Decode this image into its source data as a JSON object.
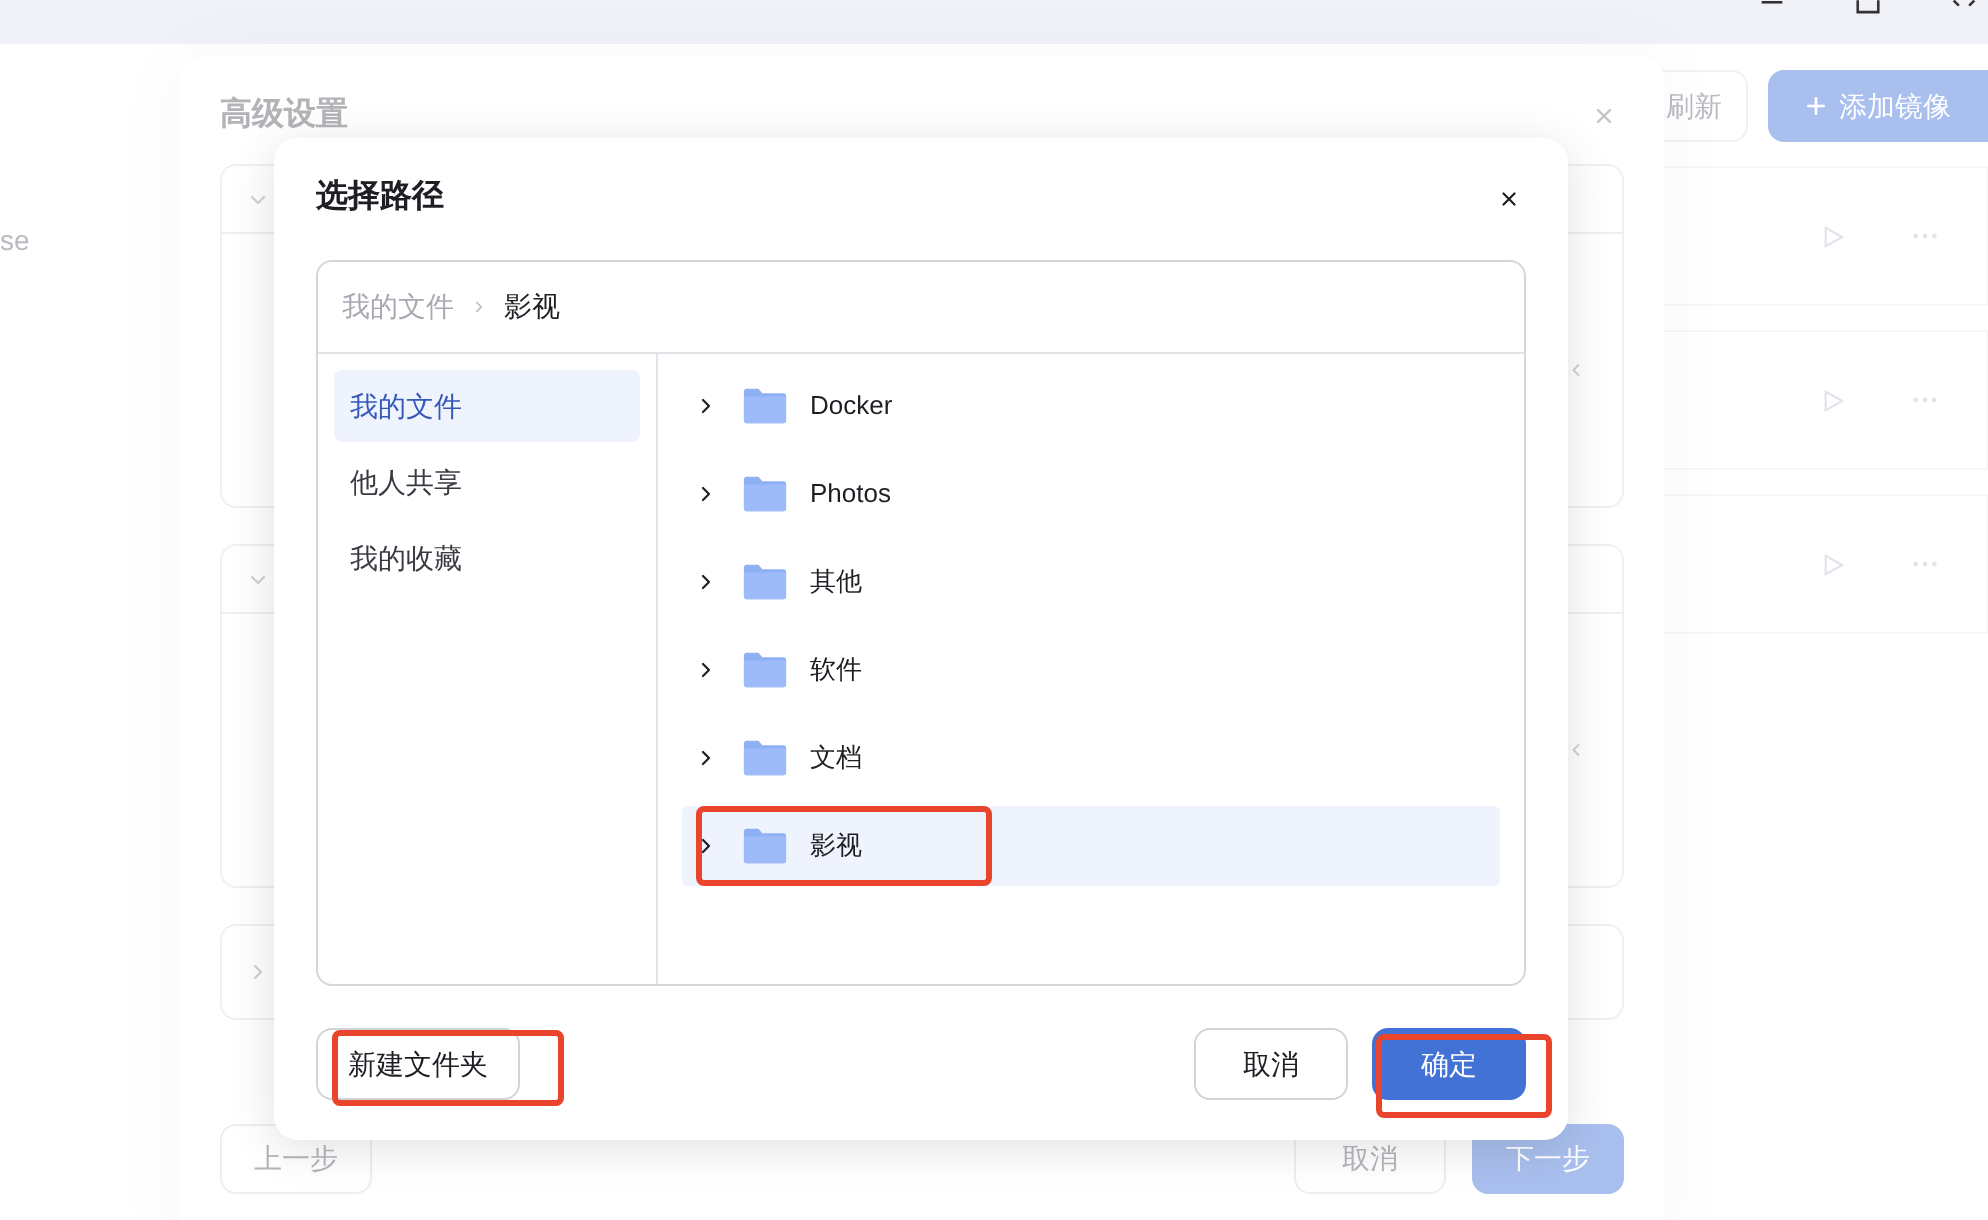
{
  "sidebar": {
    "items": [
      {
        "label": "se"
      }
    ]
  },
  "toolbar": {
    "refresh": "刷新",
    "add_image": "添加镜像",
    "add_icon": "+"
  },
  "background_list": {
    "rows": [
      {
        "kind": "row"
      },
      {
        "kind": "row"
      },
      {
        "kind": "row"
      }
    ]
  },
  "settings_dialog": {
    "title": "高级设置",
    "sections": [
      {
        "expanded": true
      },
      {
        "expanded": true
      },
      {
        "expanded": false
      }
    ],
    "buttons": {
      "back": "上一步",
      "cancel": "取消",
      "next": "下一步"
    }
  },
  "path_dialog": {
    "title": "选择路径",
    "breadcrumb": [
      {
        "label": "我的文件",
        "current": false
      },
      {
        "label": "影视",
        "current": true
      }
    ],
    "locations": [
      {
        "label": "我的文件",
        "selected": true
      },
      {
        "label": "他人共享",
        "selected": false
      },
      {
        "label": "我的收藏",
        "selected": false
      }
    ],
    "folders": [
      {
        "name": "Docker",
        "selected": false,
        "highlighted": false
      },
      {
        "name": "Photos",
        "selected": false,
        "highlighted": false
      },
      {
        "name": "其他",
        "selected": false,
        "highlighted": false
      },
      {
        "name": "软件",
        "selected": false,
        "highlighted": false
      },
      {
        "name": "文档",
        "selected": false,
        "highlighted": false
      },
      {
        "name": "影视",
        "selected": true,
        "highlighted": true
      }
    ],
    "new_folder": {
      "label": "新建文件夹",
      "highlighted": true
    },
    "cancel": {
      "label": "取消",
      "highlighted": false
    },
    "confirm": {
      "label": "确定",
      "highlighted": true
    }
  }
}
